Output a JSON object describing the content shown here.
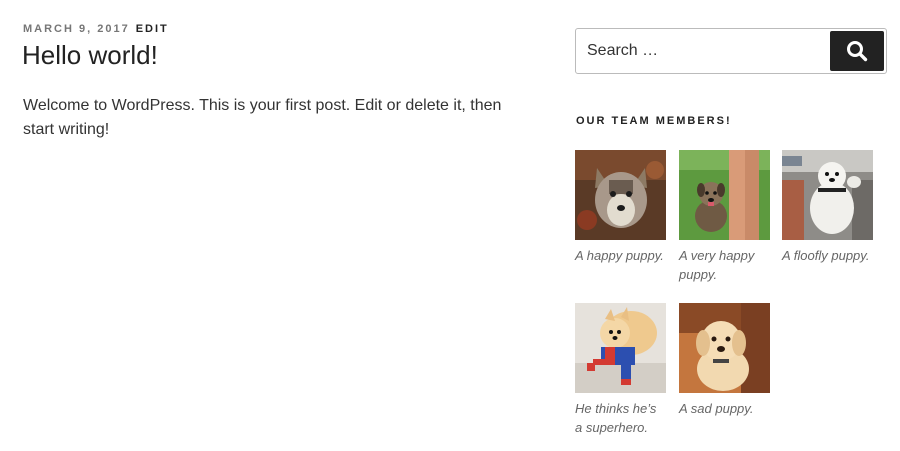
{
  "post": {
    "date": "MARCH 9, 2017",
    "edit_label": "EDIT",
    "title": "Hello world!",
    "body": "Welcome to WordPress. This is your first post. Edit or delete it, then start writing!"
  },
  "search": {
    "placeholder": "Search …",
    "button_icon": "search-icon"
  },
  "widget": {
    "title": "OUR TEAM MEMBERS!",
    "gallery": [
      {
        "caption": "A happy puppy.",
        "image": "husky-puppy-photo"
      },
      {
        "caption": "A very happy puppy.",
        "image": "puppy-on-grass-photo"
      },
      {
        "caption": "A floofly puppy.",
        "image": "white-fluffy-puppy-photo"
      },
      {
        "caption": "He thinks he’s a superhero.",
        "image": "puppy-in-costume-photo"
      },
      {
        "caption": "A sad puppy.",
        "image": "labrador-puppy-photo"
      }
    ]
  },
  "colors": {
    "text": "#333333",
    "meta_gray": "#767676",
    "button_dark": "#222222",
    "caption_gray": "#666666"
  }
}
